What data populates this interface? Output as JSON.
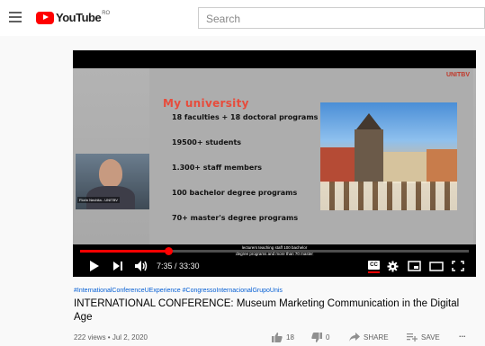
{
  "header": {
    "logo_text": "YouTube",
    "logo_region": "RO",
    "search_placeholder": "Search"
  },
  "slide": {
    "logo_text": "UNITBV",
    "title": "My university",
    "items": [
      "18 faculties + 18 doctoral programs",
      "19500+ students",
      "1.300+ staff members",
      "100 bachelor degree programs",
      "70+  master's degree programs"
    ],
    "caption_line1": "lecturers teaching staff 100 bachelor",
    "caption_line2": "degree programs and more than 70 master",
    "webcam_name": "Florin Nechita - UNITBV"
  },
  "player": {
    "time_display": "7:35 / 33:30",
    "progress_fraction": 0.226,
    "cc_label": "CC"
  },
  "video": {
    "hashtags": "#InternationalConferenceUExperience #CongressoInternacionalGrupoUnis",
    "title": "INTERNATIONAL CONFERENCE: Museum Marketing Communication in the Digital Age",
    "views_date": "222 views • Jul 2, 2020",
    "likes": "18",
    "dislikes": "0",
    "share_label": "SHARE",
    "save_label": "SAVE",
    "more_label": "..."
  },
  "colors": {
    "brand_red": "#ff0000",
    "link_blue": "#065fd4",
    "slide_title": "#e74c3c"
  }
}
